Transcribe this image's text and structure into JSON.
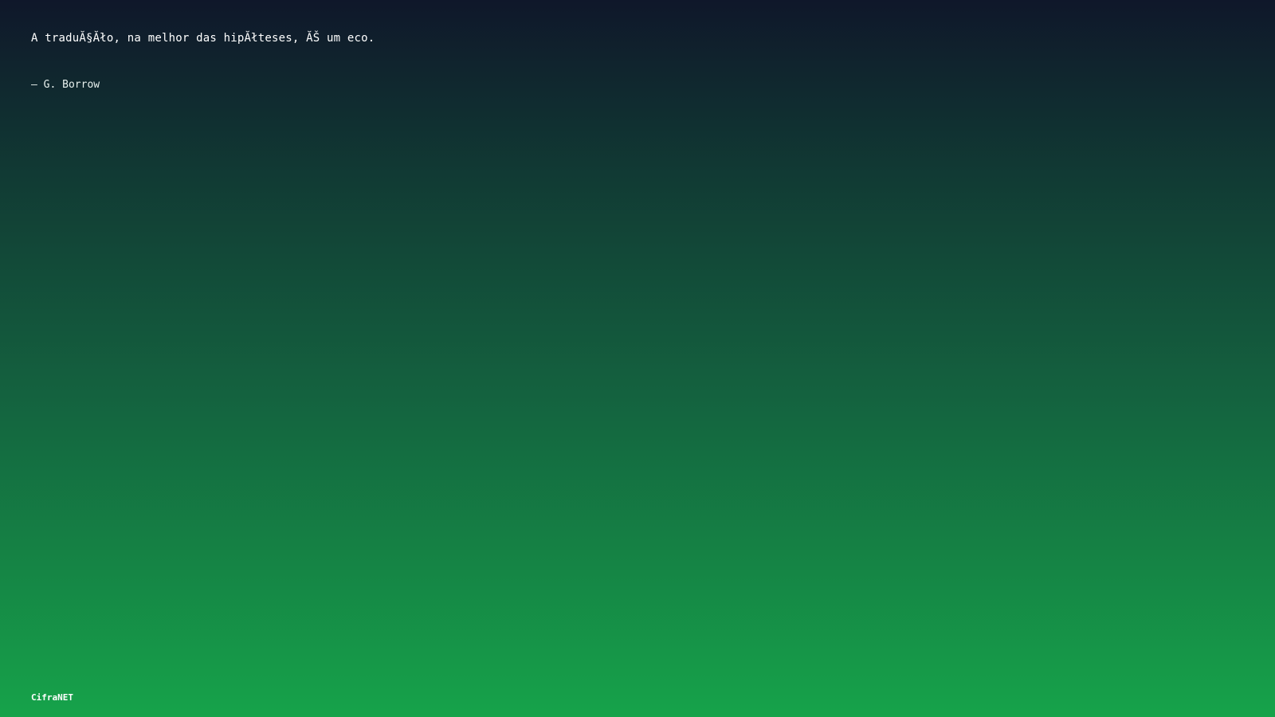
{
  "quote": {
    "text": "A traduĂ§Ăło, na melhor das hipĂłteses, ĂŠ um eco.",
    "author": "– G. Borrow"
  },
  "brand": {
    "name": "CifraNET"
  },
  "colors": {
    "gradient_top": "#0f172a",
    "gradient_bottom": "#16a34a",
    "text": "#ffffff"
  }
}
